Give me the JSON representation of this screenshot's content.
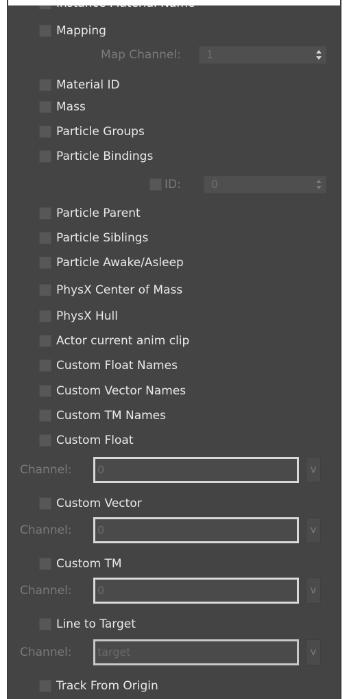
{
  "options": {
    "instance_material_name": "Instance Material Name",
    "mapping": "Mapping",
    "map_channel_label": "Map Channel:",
    "map_channel_value": "1",
    "material_id": "Material ID",
    "mass": "Mass",
    "particle_groups": "Particle Groups",
    "particle_bindings": "Particle Bindings",
    "id_label": "ID:",
    "id_value": "0",
    "particle_parent": "Particle Parent",
    "particle_siblings": "Particle Siblings",
    "particle_awake_asleep": "Particle Awake/Asleep",
    "physx_center_of_mass": "PhysX Center of Mass",
    "physx_hull": "PhysX Hull",
    "actor_current_anim_clip": "Actor current anim clip",
    "custom_float_names": "Custom Float Names",
    "custom_vector_names": "Custom Vector Names",
    "custom_tm_names": "Custom TM Names",
    "custom_float": "Custom Float",
    "custom_vector": "Custom Vector",
    "custom_tm": "Custom TM",
    "line_to_target": "Line to Target",
    "track_from_origin": "Track From Origin"
  },
  "channels": {
    "label": "Channel:",
    "dropdown_glyph": "v",
    "custom_float_value": "0",
    "custom_vector_value": "0",
    "custom_tm_value": "0",
    "line_to_target_value": "target"
  },
  "colors": {
    "panel_bg": "#444444",
    "checkbox_bg": "#575757",
    "label_text": "#eaeaea",
    "disabled_text": "#7a7a7a",
    "input_border": "#d9d9d9"
  }
}
